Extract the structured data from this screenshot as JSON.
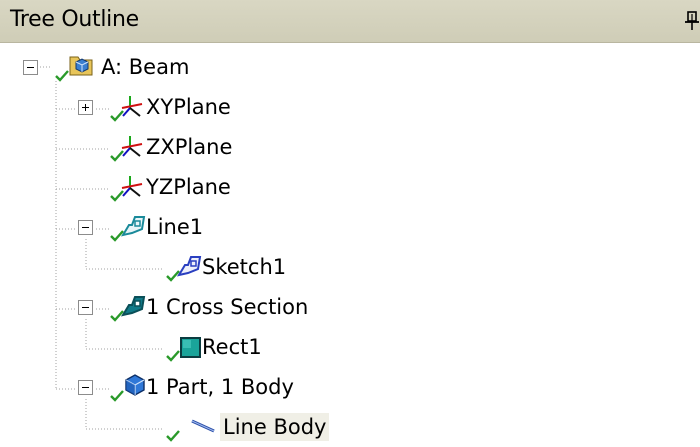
{
  "panel": {
    "title": "Tree Outline"
  },
  "tree": {
    "nodes": [
      {
        "label": "A: Beam",
        "icon": "model-box-icon",
        "expander": "minus"
      },
      {
        "label": "XYPlane",
        "icon": "plane-axes-icon",
        "expander": "plus"
      },
      {
        "label": "ZXPlane",
        "icon": "plane-axes-icon",
        "expander": "none"
      },
      {
        "label": "YZPlane",
        "icon": "plane-axes-icon",
        "expander": "none"
      },
      {
        "label": "Line1",
        "icon": "sketch-plane-icon",
        "expander": "minus"
      },
      {
        "label": "Sketch1",
        "icon": "sketch-icon",
        "expander": "none"
      },
      {
        "label": "1 Cross Section",
        "icon": "cross-section-icon",
        "expander": "minus"
      },
      {
        "label": "Rect1",
        "icon": "rectangle-section-icon",
        "expander": "none"
      },
      {
        "label": "1 Part, 1 Body",
        "icon": "part-body-icon",
        "expander": "minus"
      },
      {
        "label": "Line Body",
        "icon": "line-body-icon",
        "expander": "none",
        "selected": true
      }
    ]
  },
  "colors": {
    "titlebar": "#d9d7c3",
    "check": "#2a9a2a",
    "selection": "#f0efe6"
  }
}
